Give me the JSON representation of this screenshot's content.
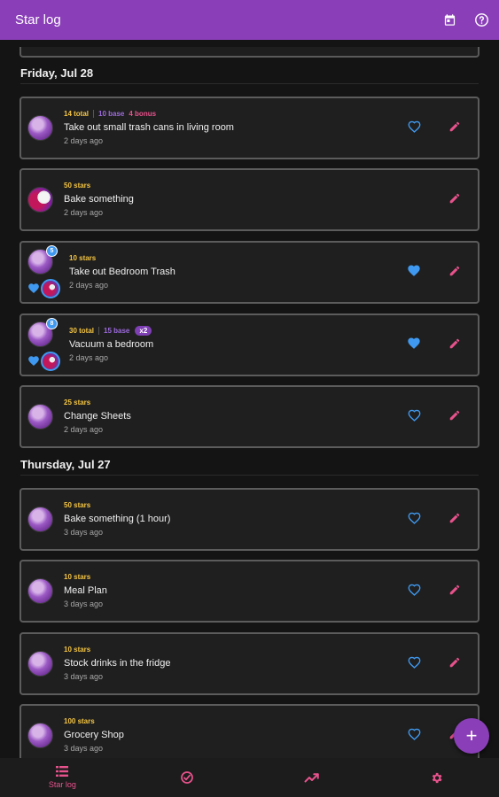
{
  "app_title": "Star log",
  "icons": {
    "calendar": "calendar-icon",
    "help": "help-icon",
    "heart": "heart-icon",
    "edit": "pencil-icon",
    "add": "plus-icon"
  },
  "colors": {
    "accent": "#8a3fb8",
    "pink": "#e8528c",
    "blue": "#3f99f0",
    "yellow": "#f5c542",
    "purple_text": "#9d6bdc"
  },
  "days": [
    {
      "label": "Friday, Jul 28",
      "entries": [
        {
          "stars": "14 total",
          "base": "10 base",
          "bonus": "4 bonus",
          "multiplier": "",
          "name": "Take out small trash cans in living room",
          "ago": "2 days ago",
          "avatar": "purple",
          "badge": "",
          "heart": "outline",
          "editable": true
        },
        {
          "stars": "50 stars",
          "base": "",
          "bonus": "",
          "multiplier": "",
          "name": "Bake something",
          "ago": "2 days ago",
          "avatar": "bake",
          "badge": "",
          "heart": "none",
          "editable": true
        },
        {
          "stars": "10 stars",
          "base": "",
          "bonus": "",
          "multiplier": "",
          "name": "Take out Bedroom Trash",
          "ago": "2 days ago",
          "avatar": "purple",
          "badge": "5",
          "heart": "filled",
          "editable": true
        },
        {
          "stars": "30 total",
          "base": "15 base",
          "bonus": "",
          "multiplier": "x2",
          "name": "Vacuum a bedroom",
          "ago": "2 days ago",
          "avatar": "purple",
          "badge": "8",
          "heart": "filled",
          "editable": true
        },
        {
          "stars": "25 stars",
          "base": "",
          "bonus": "",
          "multiplier": "",
          "name": "Change Sheets",
          "ago": "2 days ago",
          "avatar": "purple",
          "badge": "",
          "heart": "outline",
          "editable": true
        }
      ]
    },
    {
      "label": "Thursday, Jul 27",
      "entries": [
        {
          "stars": "50 stars",
          "base": "",
          "bonus": "",
          "multiplier": "",
          "name": "Bake something (1 hour)",
          "ago": "3 days ago",
          "avatar": "purple",
          "badge": "",
          "heart": "outline",
          "editable": true
        },
        {
          "stars": "10 stars",
          "base": "",
          "bonus": "",
          "multiplier": "",
          "name": "Meal Plan",
          "ago": "3 days ago",
          "avatar": "purple",
          "badge": "",
          "heart": "outline",
          "editable": true
        },
        {
          "stars": "10 stars",
          "base": "",
          "bonus": "",
          "multiplier": "",
          "name": "Stock drinks in the fridge",
          "ago": "3 days ago",
          "avatar": "purple",
          "badge": "",
          "heart": "outline",
          "editable": true
        },
        {
          "stars": "100 stars",
          "base": "",
          "bonus": "",
          "multiplier": "",
          "name": "Grocery Shop",
          "ago": "3 days ago",
          "avatar": "purple",
          "badge": "",
          "heart": "outline",
          "editable": true
        }
      ]
    }
  ],
  "fab": {
    "label": "+"
  },
  "bottom_nav": [
    {
      "label": "Star log",
      "icon": "list-icon",
      "active": true
    },
    {
      "label": "",
      "icon": "check-circle-icon",
      "active": false
    },
    {
      "label": "",
      "icon": "trending-up-icon",
      "active": false
    },
    {
      "label": "",
      "icon": "gear-icon",
      "active": false
    }
  ]
}
